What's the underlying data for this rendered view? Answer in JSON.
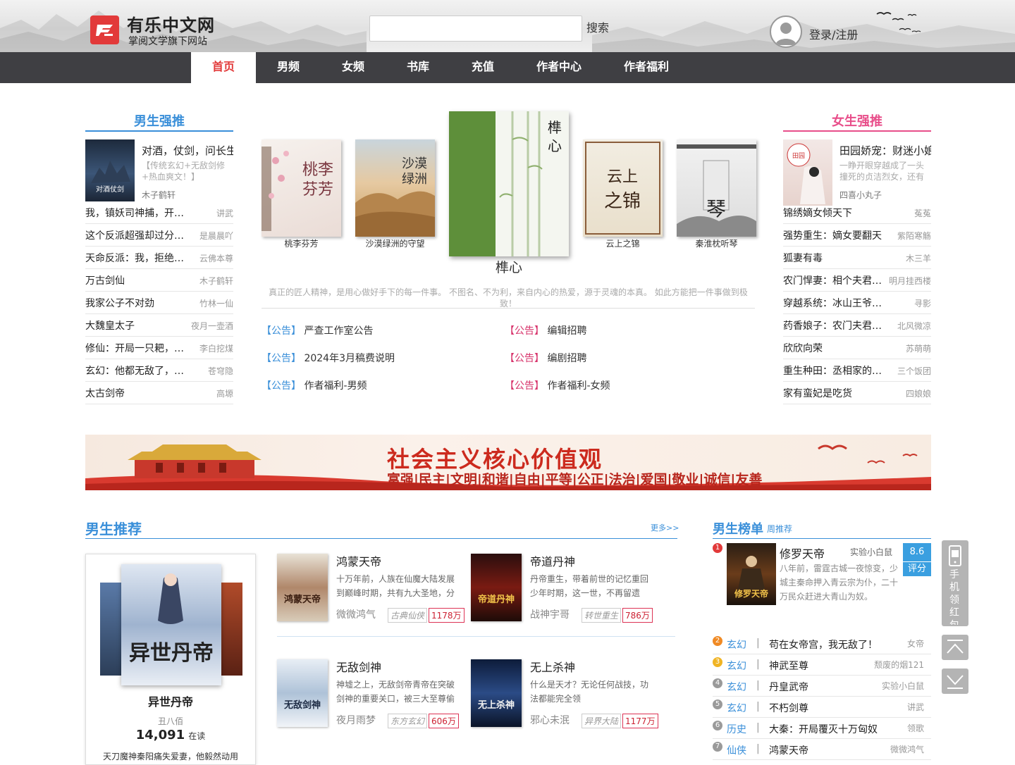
{
  "header": {
    "site_name": "有乐中文网",
    "tagline": "掌阅文学旗下网站",
    "search_placeholder": "",
    "search_label": "搜索",
    "login_label": "登录/注册"
  },
  "nav": {
    "items": [
      {
        "label": "首页",
        "active": true
      },
      {
        "label": "男频"
      },
      {
        "label": "女频"
      },
      {
        "label": "书库"
      },
      {
        "label": "充值"
      },
      {
        "label": "作者中心"
      },
      {
        "label": "作者福利"
      }
    ]
  },
  "male_picks": {
    "heading": "男生强推",
    "featured": {
      "title": "对酒，仗剑，问长生",
      "desc": "【传统玄幻+无敌剑修+热血爽文！】",
      "author": "木子鹤轩"
    },
    "items": [
      {
        "title": "我，镇妖司神捕，开局…",
        "author": "讲武"
      },
      {
        "title": "这个反派超强却过分…",
        "author": "是晨晨吖"
      },
      {
        "title": "天命反派：我，拒绝…",
        "author": "云佛本尊"
      },
      {
        "title": "万古剑仙",
        "author": "木子鹤轩"
      },
      {
        "title": "我家公子不对劲",
        "author": "竹林一仙"
      },
      {
        "title": "大魏皇太子",
        "author": "夜月一壶酒"
      },
      {
        "title": "修仙：开局一只耙，…",
        "author": "李白挖煤"
      },
      {
        "title": "玄幻：他都无敌了，…",
        "author": "苍穹隐"
      },
      {
        "title": "太古剑帝",
        "author": "高塬"
      }
    ]
  },
  "female_picks": {
    "heading": "女生强推",
    "featured": {
      "title": "田园娇宠：财迷小娘子",
      "desc": "一睁开眼穿越成了一头撞死的贞洁烈女，还有",
      "author": "四喜小丸子"
    },
    "items": [
      {
        "title": "锦绣嫡女倾天下",
        "author": "菟菟"
      },
      {
        "title": "强势重生：嫡女要翻天",
        "author": "紫陌寒觞"
      },
      {
        "title": "狐妻有毒",
        "author": "木三羊"
      },
      {
        "title": "农门悍妻：相个夫君…",
        "author": "明月挂西楼"
      },
      {
        "title": "穿越系统：冰山王爷…",
        "author": "寻影"
      },
      {
        "title": "药香娘子：农门夫君…",
        "author": "北风微凉"
      },
      {
        "title": "欣欣向荣",
        "author": "苏萌萌"
      },
      {
        "title": "重生种田：丞相家的…",
        "author": "三个饭团"
      },
      {
        "title": "家有蛮妃是吃货",
        "author": "四娘娘"
      }
    ]
  },
  "carousel": {
    "covers": [
      {
        "caption": "桃李芬芳",
        "art": "桃李芬芳"
      },
      {
        "caption": "沙漠绿洲的守望",
        "art": "沙漠绿洲"
      },
      {
        "caption": "榫心",
        "art": "榫心"
      },
      {
        "caption": "云上之锦",
        "art": "云上之锦"
      },
      {
        "caption": "秦淮枕听琴",
        "art": "琴"
      }
    ],
    "featured_title": "榫心",
    "slogan": "真正的匠人精神，是用心做好手下的每一件事。 不图名、不为利，来自内心的热爱，源于灵魂的本真。 如此方能把一件事做到极致！"
  },
  "notices": {
    "tag": "【公告】",
    "left": [
      "严查工作室公告",
      "2024年3月稿费说明",
      "作者福利-男频"
    ],
    "right": [
      "编辑招聘",
      "编剧招聘",
      "作者福利-女频"
    ]
  },
  "banner": {
    "title": "社会主义核心价值观",
    "subtitle": "富强|民主|文明|和谐|自由|平等|公正|法治|爱国|敬业|诚信|友善"
  },
  "male_recommend": {
    "heading": "男生推荐",
    "more": "更多>>",
    "featured": {
      "title": "异世丹帝",
      "author": "丑八佰",
      "reading_count": "14,091",
      "reading_label": "在读",
      "desc": "天刀魔神秦阳痛失爱妻，他毅然动用"
    },
    "books": [
      {
        "title": "鸿蒙天帝",
        "desc": "十万年前，人族在仙魔大陆发展到巅峰时期，共有九大圣地，分",
        "author": "微微鸿气",
        "genre": "古典仙侠",
        "count": "1178万",
        "cover_text": "鸿蒙天帝"
      },
      {
        "title": "帝道丹神",
        "desc": "丹帝重生，带着前世的记忆重回少年时期，这一世，不再留遗",
        "author": "战神宇哥",
        "genre": "转世重生",
        "count": "786万",
        "cover_text": "帝道丹神"
      },
      {
        "title": "无敌剑神",
        "desc": "神墟之上，无敌剑帝青帝在突破剑神的重要关口，被三大至尊偷",
        "author": "夜月雨梦",
        "genre": "东方玄幻",
        "count": "606万",
        "cover_text": "无敌剑神"
      },
      {
        "title": "无上杀神",
        "desc": "什么是天才？无论任何战技，功法都能完全领",
        "author": "邪心未泯",
        "genre": "异界大陆",
        "count": "1177万",
        "cover_text": "无上杀神"
      }
    ]
  },
  "male_rank": {
    "heading": "男生榜单",
    "sub": "周推荐",
    "top": {
      "num": "1",
      "title": "修罗天帝",
      "author": "实验小白鼠",
      "score": "8.6",
      "score_label": "评分",
      "desc": "八年前，雷霆古城一夜惊变，少城主秦命押入青云宗为仆，二十万民众赶进大青山为奴。",
      "cover_text": "修罗天帝"
    },
    "items": [
      {
        "num": "2",
        "genre": "玄幻",
        "title": "苟在女帝宫，我无敌了！",
        "author": "女帝"
      },
      {
        "num": "3",
        "genre": "玄幻",
        "title": "神武至尊",
        "author": "颓废的烟121"
      },
      {
        "num": "4",
        "genre": "玄幻",
        "title": "丹皇武帝",
        "author": "实验小白鼠"
      },
      {
        "num": "5",
        "genre": "玄幻",
        "title": "不朽剑尊",
        "author": "讲武"
      },
      {
        "num": "6",
        "genre": "历史",
        "title": "大秦：开局覆灭十万匈奴",
        "author": "领歌"
      },
      {
        "num": "7",
        "genre": "仙侠",
        "title": "鸿蒙天帝",
        "author": "微微鸿气"
      }
    ]
  },
  "side_tools": {
    "mobile_label": "手机领红包"
  },
  "colors": {
    "nav_bg": "#3f3f43",
    "accent_red": "#e23a3a",
    "link_blue": "#3a8fd9",
    "female_pink": "#e84e8a"
  }
}
